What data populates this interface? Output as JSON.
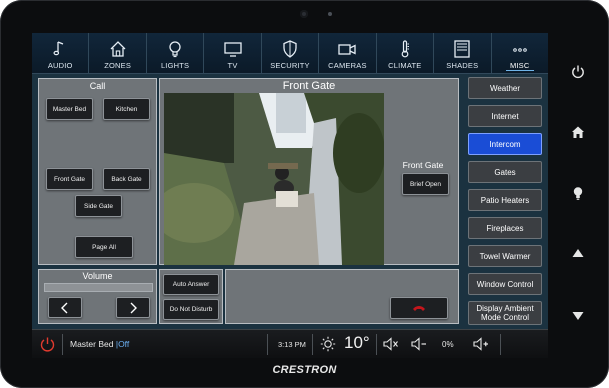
{
  "nav": [
    {
      "label": "AUDIO",
      "icon": "music-note-icon"
    },
    {
      "label": "ZONES",
      "icon": "house-icon"
    },
    {
      "label": "LIGHTS",
      "icon": "lightbulb-icon"
    },
    {
      "label": "TV",
      "icon": "tv-icon"
    },
    {
      "label": "SECURITY",
      "icon": "shield-icon"
    },
    {
      "label": "CAMERAS",
      "icon": "camera-icon"
    },
    {
      "label": "CLIMATE",
      "icon": "thermometer-icon"
    },
    {
      "label": "SHADES",
      "icon": "shades-icon"
    },
    {
      "label": "MISC",
      "icon": "more-dots-icon",
      "active": true
    }
  ],
  "call": {
    "title": "Call",
    "buttons": [
      "Master Bed",
      "Kitchen",
      "Front Gate",
      "Back Gate",
      "Side Gate",
      "Page All"
    ]
  },
  "camera": {
    "title": "Front Gate",
    "side_title": "Front Gate",
    "brief_open": "Brief Open"
  },
  "volume": {
    "title": "Volume",
    "level": 0
  },
  "intercom_options": {
    "auto_answer": "Auto Answer",
    "do_not_disturb": "Do Not Disturb"
  },
  "right_menu": [
    {
      "label": "Weather"
    },
    {
      "label": "Internet"
    },
    {
      "label": "Intercom",
      "active": true
    },
    {
      "label": "Gates"
    },
    {
      "label": "Patio Heaters"
    },
    {
      "label": "Fireplaces"
    },
    {
      "label": "Towel Warmer"
    },
    {
      "label": "Window Control"
    },
    {
      "label": "Display Ambient Mode Control"
    }
  ],
  "status_bar": {
    "room": "Master Bed",
    "separator": "|",
    "power_state": "Off",
    "time": "3:13 PM",
    "temperature": "10°",
    "volume_percent": "0%"
  },
  "brand": "CRESTRON",
  "colors": {
    "accent_active": "#1a4dd6",
    "hangup_red": "#c4161c",
    "power_off": "#e23a2e"
  }
}
